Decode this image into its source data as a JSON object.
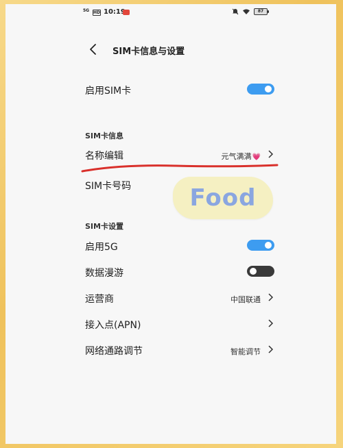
{
  "status_bar": {
    "network": "5G",
    "hd_badge": "HD",
    "time": "10:19",
    "battery": "87"
  },
  "header": {
    "title": "SIM卡信息与设置"
  },
  "enable_sim": {
    "label": "启用SIM卡",
    "enabled": true
  },
  "sim_info": {
    "section_title": "SIM卡信息",
    "name_edit": {
      "label": "名称编辑",
      "value": "元气满满",
      "value_emoji": "💗"
    },
    "sim_number": {
      "label": "SIM卡号码"
    }
  },
  "sim_settings": {
    "section_title": "SIM卡设置",
    "enable_5g": {
      "label": "启用5G",
      "enabled": true
    },
    "data_roaming": {
      "label": "数据漫游",
      "enabled": false
    },
    "carrier": {
      "label": "运营商",
      "value": "中国联通"
    },
    "apn": {
      "label": "接入点(APN)"
    },
    "network_path": {
      "label": "网络通路调节",
      "value": "智能调节"
    }
  },
  "sticker": {
    "text": "Food"
  },
  "colors": {
    "accent_toggle_on": "#3d9cf0",
    "toggle_off": "#3a3a3a",
    "annotation_red": "#d9302b",
    "frame_yellow": "#f3c86a"
  }
}
